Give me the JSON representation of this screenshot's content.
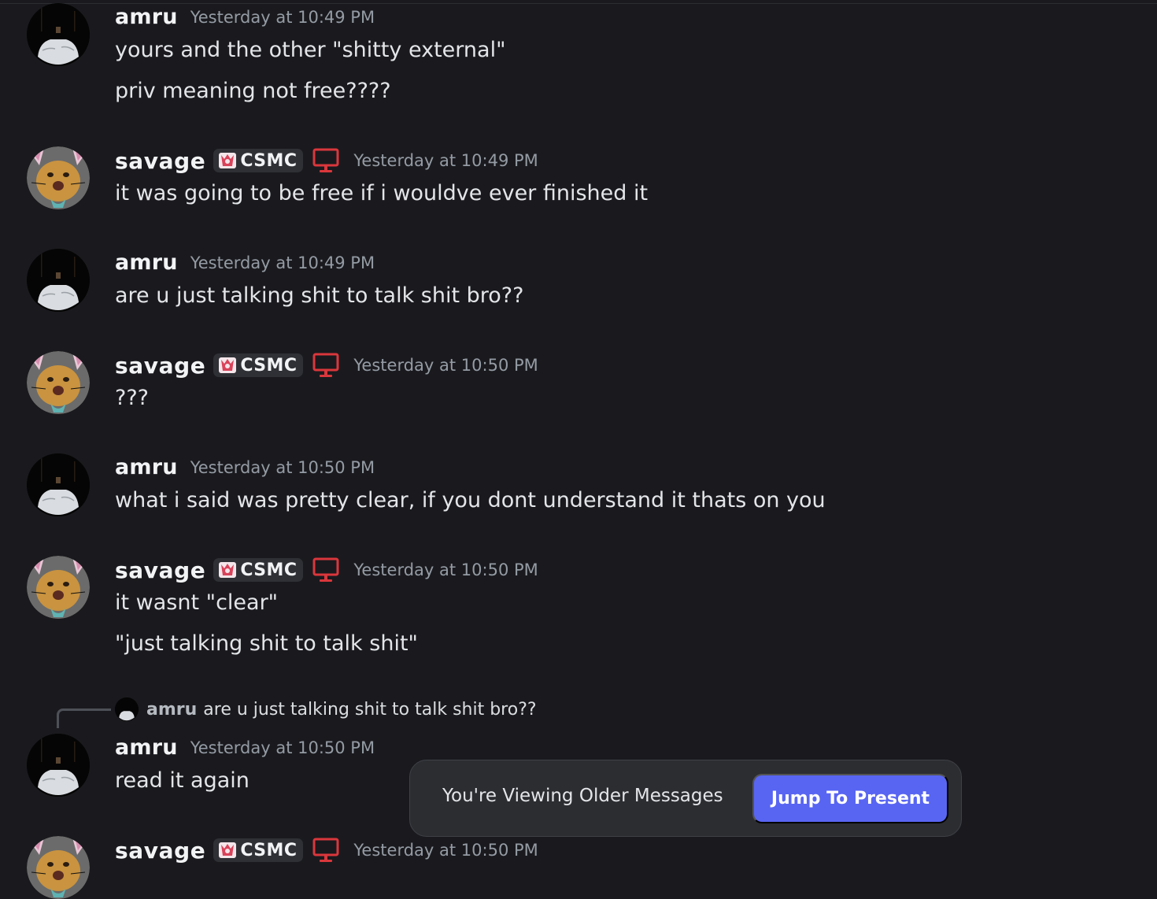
{
  "colors": {
    "background": "#1a1a1e",
    "username": "#f2f3f5",
    "timestamp": "#949ba4",
    "badge_bg": "#2e3035",
    "monitor_icon": "#da373c",
    "jump_button": "#5865f2"
  },
  "messages": [
    {
      "author": "amru",
      "timestamp": "Yesterday at 10:49 PM",
      "lines": [
        "yours and the other \"shitty external\"",
        "priv meaning not free????"
      ]
    },
    {
      "author": "savage",
      "badge": "CSMC",
      "icons": [
        "clan-badge-icon",
        "monitor-icon"
      ],
      "timestamp": "Yesterday at 10:49 PM",
      "lines": [
        "it was going to be free if i wouldve ever finished it"
      ]
    },
    {
      "author": "amru",
      "timestamp": "Yesterday at 10:49 PM",
      "lines": [
        "are u just talking shit to talk shit bro??"
      ]
    },
    {
      "author": "savage",
      "badge": "CSMC",
      "icons": [
        "clan-badge-icon",
        "monitor-icon"
      ],
      "timestamp": "Yesterday at 10:50 PM",
      "lines": [
        "???"
      ]
    },
    {
      "author": "amru",
      "timestamp": "Yesterday at 10:50 PM",
      "lines": [
        "what i said was pretty clear, if you dont understand it thats on you"
      ]
    },
    {
      "author": "savage",
      "badge": "CSMC",
      "icons": [
        "clan-badge-icon",
        "monitor-icon"
      ],
      "timestamp": "Yesterday at 10:50 PM",
      "lines": [
        "it wasnt \"clear\"",
        "\"just talking shit to talk shit\""
      ]
    },
    {
      "author": "amru",
      "timestamp": "Yesterday at 10:50 PM",
      "reply_to": {
        "author": "amru",
        "text": "are u just talking shit to talk shit bro??"
      },
      "lines": [
        "read it again"
      ]
    },
    {
      "author": "savage",
      "badge": "CSMC",
      "icons": [
        "clan-badge-icon",
        "monitor-icon"
      ],
      "timestamp": "Yesterday at 10:50 PM",
      "lines": []
    }
  ],
  "older_messages_bar": {
    "text": "You're Viewing Older Messages",
    "button_label": "Jump To Present"
  }
}
